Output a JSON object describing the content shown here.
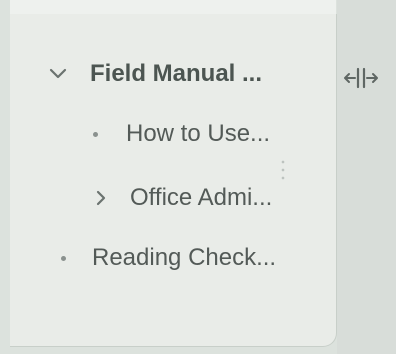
{
  "tree": {
    "root": {
      "label": "Field Manual ...",
      "expanded": true,
      "children": [
        {
          "label": "How to Use..."
        },
        {
          "label": "Office Admi...",
          "collapsed": true
        }
      ]
    },
    "sibling": {
      "label": "Reading Check..."
    }
  },
  "icons": {
    "expand": "chevron-down-icon",
    "collapse": "chevron-right-icon",
    "bullet": "bullet-icon",
    "resize": "resize-horizontal-icon"
  },
  "colors": {
    "text": "#535a57",
    "icon": "#6b7370",
    "panel": "#e9ece8",
    "background": "#dce2dd"
  }
}
